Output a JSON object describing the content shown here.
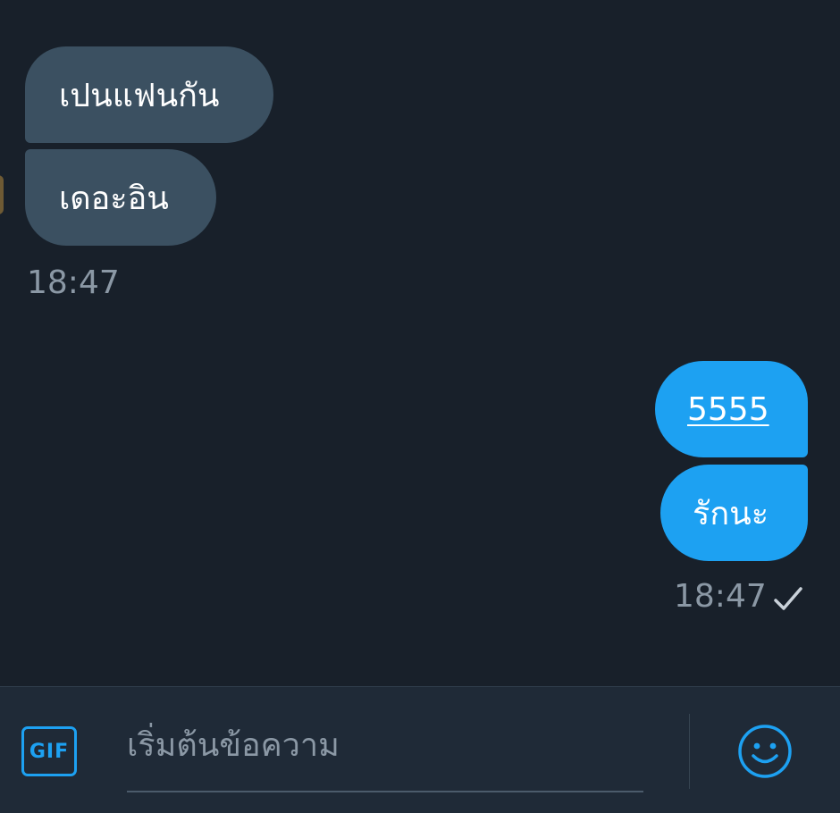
{
  "conversation": {
    "incoming": [
      {
        "text": "เปนแฟนกัน"
      },
      {
        "text": "เดอะอิน"
      }
    ],
    "incoming_time": "18:47",
    "outgoing": [
      {
        "text": "5555"
      },
      {
        "text": "รักนะ"
      }
    ],
    "outgoing_time": "18:47",
    "outgoing_status_icon": "check-icon"
  },
  "composer": {
    "gif_label": "GIF",
    "placeholder": "เริ่มต้นข้อความ",
    "value": "",
    "emoji_icon": "smiley-icon"
  },
  "colors": {
    "background": "#18202a",
    "incoming_bubble": "#3b5061",
    "outgoing_bubble": "#1da1f2",
    "accent": "#1da1f2",
    "timestamp": "#8b98a5"
  }
}
